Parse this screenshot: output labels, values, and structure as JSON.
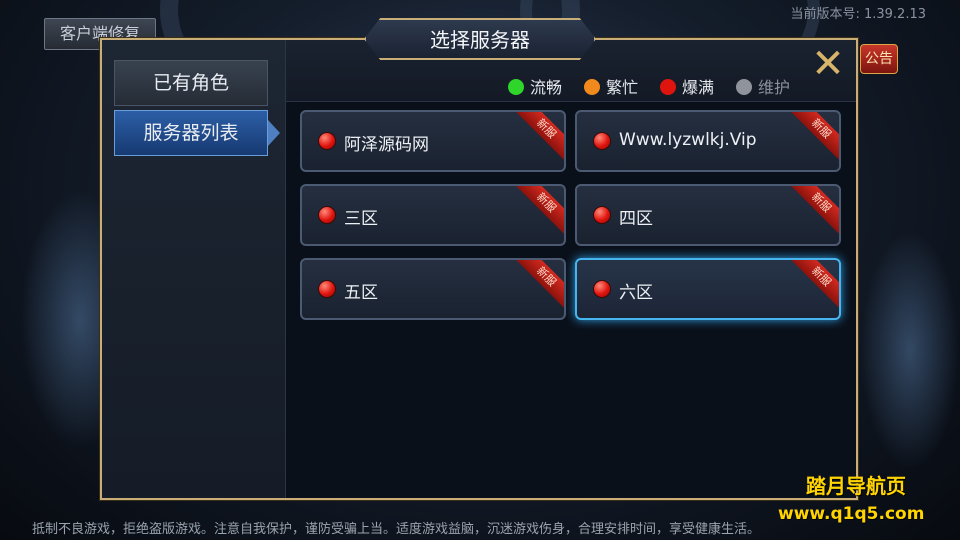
{
  "top": {
    "repair_label": "客户端修复",
    "version_text": "当前版本号: 1.39.2.13",
    "notice_label": "公告"
  },
  "dialog": {
    "title": "选择服务器",
    "close_icon": "close-x-icon",
    "tabs": [
      {
        "label": "已有角色"
      },
      {
        "label": "服务器列表",
        "active": true
      }
    ],
    "legend": [
      {
        "label": "流畅",
        "color": "#2fd52a"
      },
      {
        "label": "繁忙",
        "color": "#f08a1c"
      },
      {
        "label": "爆满",
        "color": "#e0140e"
      },
      {
        "label": "维护",
        "color": "#8f949c"
      }
    ],
    "servers": [
      {
        "name": "阿泽源码网",
        "status": "爆满",
        "tag": "新服"
      },
      {
        "name": "Www.lyzwlkj.Vip",
        "status": "爆满",
        "tag": "新服"
      },
      {
        "name": "三区",
        "status": "爆满",
        "tag": "新服"
      },
      {
        "name": "四区",
        "status": "爆满",
        "tag": "新服"
      },
      {
        "name": "五区",
        "status": "爆满",
        "tag": "新服"
      },
      {
        "name": "六区",
        "status": "爆满",
        "tag": "新服",
        "selected": true
      }
    ]
  },
  "footer": {
    "notice": "抵制不良游戏，拒绝盗版游戏。注意自我保护，谨防受骗上当。适度游戏益脑，沉迷游戏伤身，合理安排时间，享受健康生活。"
  },
  "watermark": {
    "line1": "踏月导航页",
    "line2": "www.q1q5.com"
  }
}
